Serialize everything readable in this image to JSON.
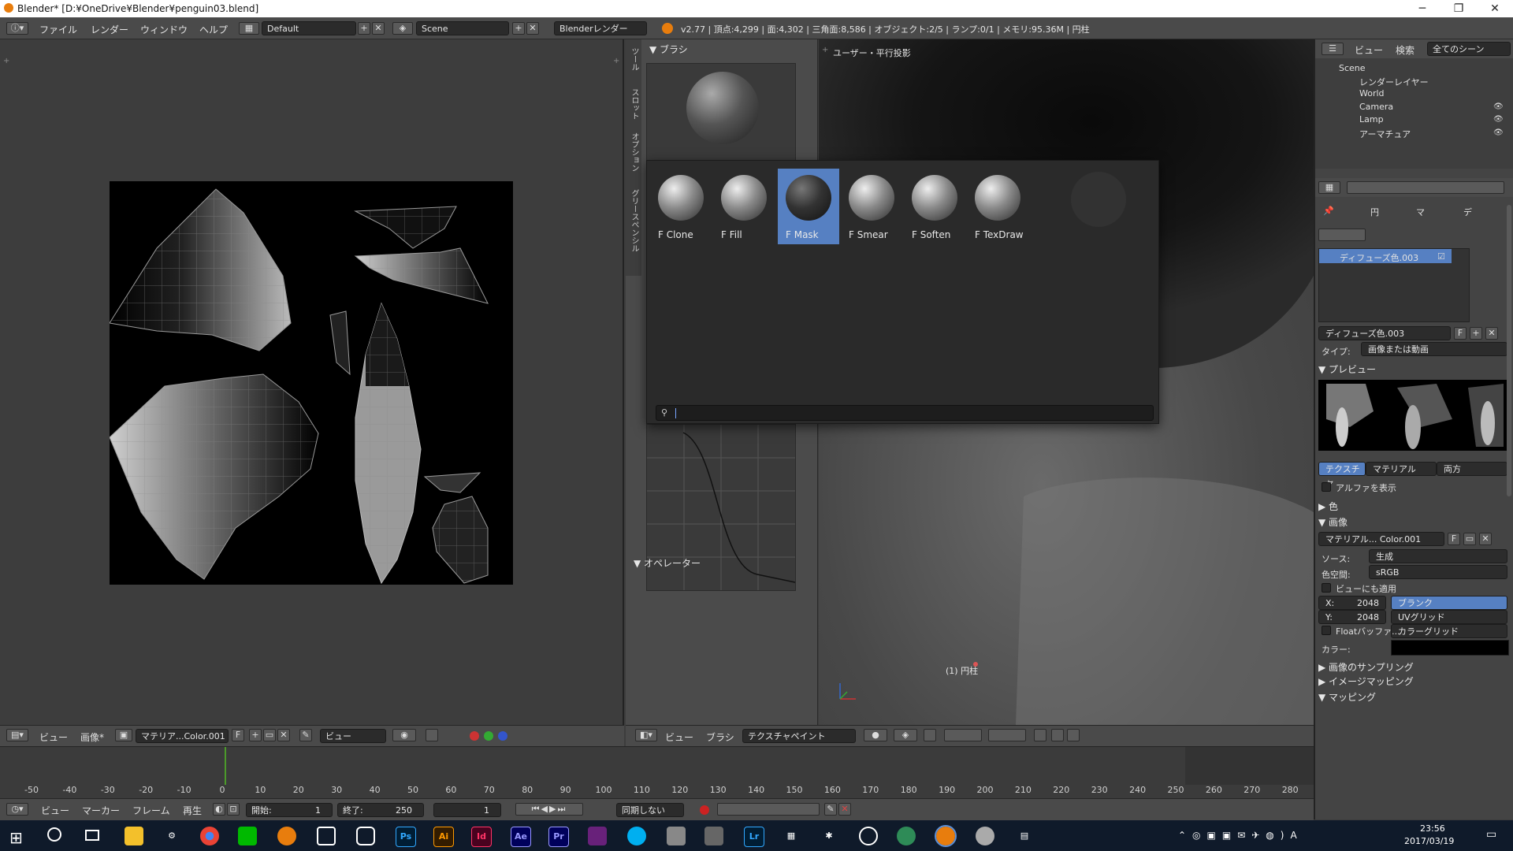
{
  "window": {
    "title": "Blender* [D:¥OneDrive¥Blender¥penguin03.blend]"
  },
  "info": {
    "menus": [
      "ファイル",
      "レンダー",
      "ウィンドウ",
      "ヘルプ"
    ],
    "layout": "Default",
    "scene": "Scene",
    "render_engine": "Blenderレンダー",
    "stats": "v2.77 | 頂点:4,299 | 面:4,302 | 三角面:8,586 | オブジェクト:2/5 | ランプ:0/1 | メモリ:95.36M | 円柱"
  },
  "tool_panel": {
    "brush_section": "ブラシ",
    "operator_section": "オペレーター",
    "tabs": [
      "ツール",
      "スロット",
      "オプション",
      "グリースペンシル"
    ]
  },
  "brush_popup": {
    "brushes": [
      {
        "name": "F Clone",
        "selected": false
      },
      {
        "name": "F Fill",
        "selected": false
      },
      {
        "name": "F Mask",
        "selected": true
      },
      {
        "name": "F Smear",
        "selected": false
      },
      {
        "name": "F Soften",
        "selected": false
      },
      {
        "name": "F TexDraw",
        "selected": false
      }
    ],
    "search_value": ""
  },
  "viewport": {
    "view_label": "ユーザー・平行投影",
    "object_label": "(1) 円柱",
    "header": {
      "view": "ビュー",
      "brush": "ブラシ",
      "mode": "テクスチャペイント"
    }
  },
  "uv_editor": {
    "header": {
      "view": "ビュー",
      "image_menu": "画像*",
      "image_name": "マテリア...Color.001",
      "f": "F",
      "view_dropdown": "ビュー"
    }
  },
  "timeline": {
    "ticks": [
      "-50",
      "-40",
      "-30",
      "-20",
      "-10",
      "0",
      "10",
      "20",
      "30",
      "40",
      "50",
      "60",
      "70",
      "80",
      "90",
      "100",
      "110",
      "120",
      "130",
      "140",
      "150",
      "160",
      "170",
      "180",
      "190",
      "200",
      "210",
      "220",
      "230",
      "240",
      "250",
      "260",
      "270",
      "280"
    ],
    "current_frame_value": 0,
    "menus": [
      "ビュー",
      "マーカー",
      "フレーム",
      "再生"
    ],
    "start_label": "開始:",
    "start": "1",
    "end_label": "終了:",
    "end": "250",
    "current": "1",
    "sync": "同期しない"
  },
  "outliner": {
    "header": {
      "view": "ビュー",
      "search": "検索",
      "scenes": "全てのシーン"
    },
    "items": [
      "Scene",
      "レンダーレイヤー",
      "World",
      "Camera",
      "Lamp",
      "アーマチュア"
    ]
  },
  "properties": {
    "breadcrumb": [
      "円",
      "マ",
      "デ"
    ],
    "texture_slot": "ディフューズ色.003",
    "texture_name": "ディフューズ色.003",
    "type_label": "タイプ:",
    "type_value": "画像または動画",
    "preview_section": "プレビュー",
    "preview_tabs": [
      "テクスチャ",
      "マテリアル",
      "両方"
    ],
    "show_alpha": "アルファを表示",
    "color_section": "色",
    "image_section": "画像",
    "image_name": "マテリアル... Color.001",
    "f": "F",
    "source_label": "ソース:",
    "source_value": "生成",
    "colorspace_label": "色空間:",
    "colorspace_value": "sRGB",
    "view_as_render": "ビューにも適用",
    "x_label": "X:",
    "x_value": "2048",
    "y_label": "Y:",
    "y_value": "2048",
    "float_buffer": "Floatバッファ...",
    "generated_types": [
      "ブランク",
      "UVグリッド",
      "カラーグリッド"
    ],
    "color_label": "カラー:",
    "sampling_section": "画像のサンプリング",
    "mapping_section": "イメージマッピング",
    "mapping2_section": "マッピング"
  },
  "taskbar": {
    "apps": [
      "Ps",
      "Ai",
      "Id",
      "Ae",
      "Pr",
      "Lr"
    ],
    "time": "23:56",
    "date": "2017/03/19"
  }
}
